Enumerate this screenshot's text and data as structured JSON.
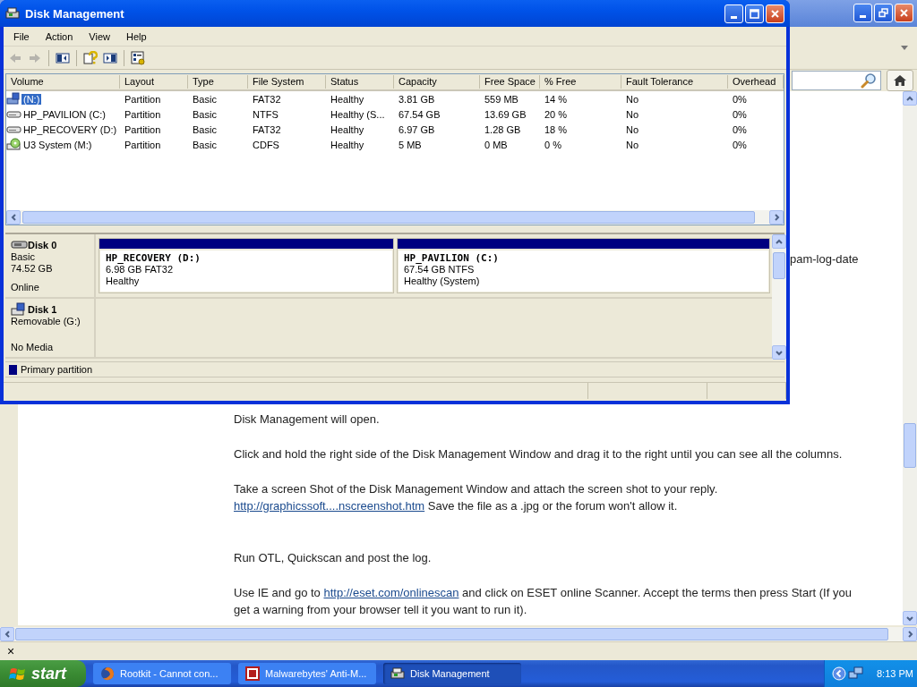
{
  "browser": {
    "page": {
      "fragment": "pam-log-date",
      "paragraphs": [
        {
          "kind": "text",
          "parts": [
            {
              "kind": "text",
              "text": "Disk Management will open."
            }
          ]
        },
        {
          "kind": "text",
          "parts": [
            {
              "kind": "text",
              "text": "Click and hold the right side of the Disk Management Window and drag it to the right until you can see all the columns."
            }
          ]
        },
        {
          "kind": "text",
          "parts": [
            {
              "kind": "text",
              "text": "Take a screen Shot of the Disk Management Window and attach the screen shot to your reply. "
            },
            {
              "kind": "link",
              "text": "http://graphicssoft....nscreenshot.htm"
            },
            {
              "kind": "text",
              "text": " Save the file as a .jpg or the forum won't allow it."
            }
          ]
        },
        {
          "kind": "spaced",
          "parts": [
            {
              "kind": "text",
              "text": "Run OTL, Quickscan and post the log."
            }
          ]
        },
        {
          "kind": "text",
          "parts": [
            {
              "kind": "text",
              "text": "Use IE and go to "
            },
            {
              "kind": "link",
              "text": "http://eset.com/onlinescan"
            },
            {
              "kind": "text",
              "text": " and click on ESET online Scanner. Accept the terms then press Start (If you get a warning from your browser tell it you want to run it)."
            }
          ]
        }
      ]
    },
    "find_bar": {
      "close": "×"
    }
  },
  "window": {
    "title": "Disk Management",
    "menu": [
      "File",
      "Action",
      "View",
      "Help"
    ],
    "toolbar": [
      {
        "kind": "back",
        "disabled": true
      },
      {
        "kind": "forward",
        "disabled": true
      },
      {
        "kind": "sep"
      },
      {
        "kind": "tree"
      },
      {
        "kind": "sep"
      },
      {
        "kind": "help"
      },
      {
        "kind": "pane"
      },
      {
        "kind": "sep"
      },
      {
        "kind": "properties"
      }
    ],
    "table": {
      "columns": [
        "Volume",
        "Layout",
        "Type",
        "File System",
        "Status",
        "Capacity",
        "Free Space",
        "% Free",
        "Fault Tolerance",
        "Overhead"
      ],
      "rows": [
        {
          "kind": "usb",
          "selected": true,
          "cells": [
            "(N:)",
            "Partition",
            "Basic",
            "FAT32",
            "Healthy",
            "3.81 GB",
            "559 MB",
            "14 %",
            "No",
            "0%"
          ]
        },
        {
          "kind": "disk",
          "selected": false,
          "cells": [
            "HP_PAVILION (C:)",
            "Partition",
            "Basic",
            "NTFS",
            "Healthy (S...",
            "67.54 GB",
            "13.69 GB",
            "20 %",
            "No",
            "0%"
          ]
        },
        {
          "kind": "disk",
          "selected": false,
          "cells": [
            "HP_RECOVERY (D:)",
            "Partition",
            "Basic",
            "FAT32",
            "Healthy",
            "6.97 GB",
            "1.28 GB",
            "18 %",
            "No",
            "0%"
          ]
        },
        {
          "kind": "cdrom",
          "selected": false,
          "cells": [
            "U3 System (M:)",
            "Partition",
            "Basic",
            "CDFS",
            "Healthy",
            "5 MB",
            "0 MB",
            "0 %",
            "No",
            "0%"
          ]
        }
      ]
    },
    "disks": [
      {
        "kind": "disk",
        "name": "Disk 0",
        "info": [
          "Basic",
          "74.52 GB"
        ],
        "status": "Online",
        "partitions": [
          {
            "name": "HP_RECOVERY  (D:)",
            "detail": "6.98 GB FAT32",
            "status": "Healthy",
            "color": "#000080"
          },
          {
            "name": "HP_PAVILION  (C:)",
            "detail": "67.54 GB NTFS",
            "status": "Healthy (System)",
            "color": "#000080"
          }
        ]
      },
      {
        "kind": "removable",
        "name": "Disk 1",
        "info": [
          "Removable (G:)"
        ],
        "status": "No Media"
      }
    ],
    "legend": [
      {
        "label": "Primary partition",
        "color": "#000080"
      }
    ]
  },
  "taskbar": {
    "start": "start",
    "tasks": [
      {
        "kind": "firefox",
        "label": "Rootkit - Cannot con...",
        "selected": false
      },
      {
        "kind": "malware",
        "label": "Malwarebytes' Anti-M...",
        "selected": false
      },
      {
        "kind": "diskmgmt",
        "label": "Disk Management",
        "selected": true
      }
    ],
    "clock": "8:13 PM"
  }
}
